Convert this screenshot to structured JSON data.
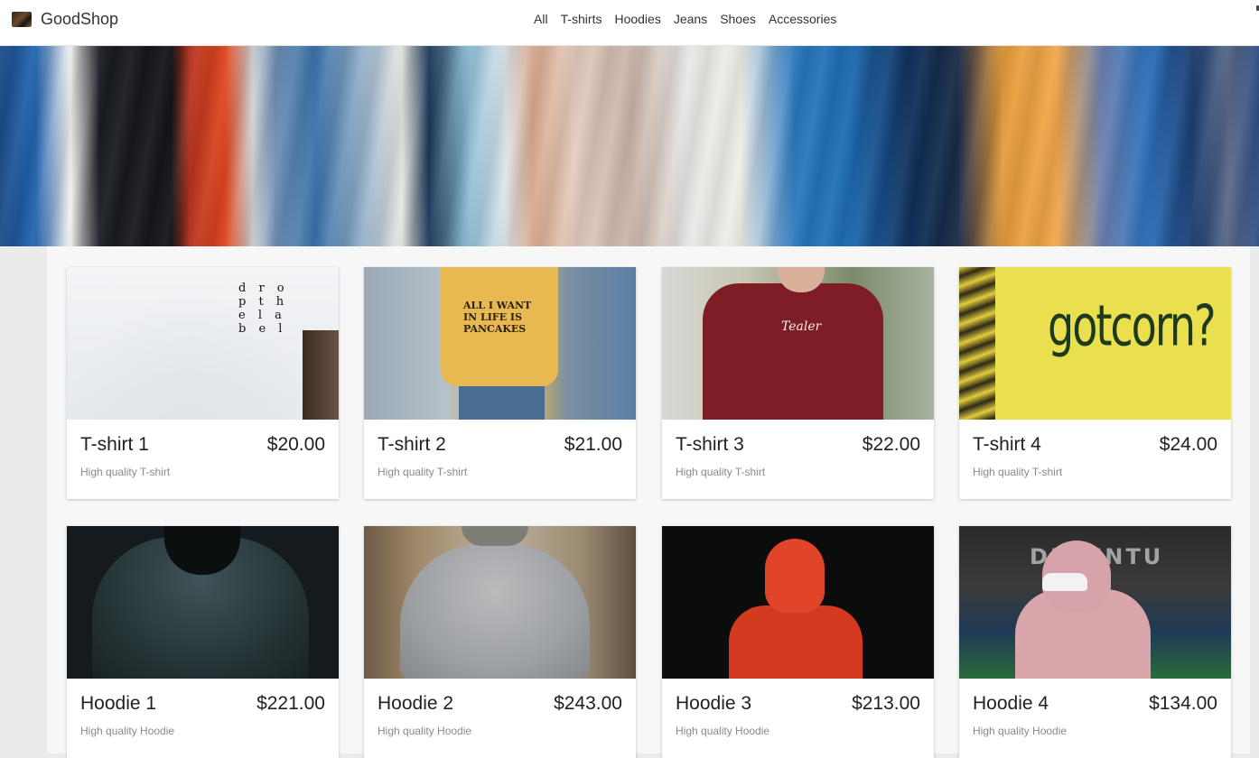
{
  "header": {
    "brand": "GoodShop",
    "nav": [
      "All",
      "T-shirts",
      "Hoodies",
      "Jeans",
      "Shoes",
      "Accessories"
    ]
  },
  "products": [
    {
      "name": "T-shirt 1",
      "price": "$20.00",
      "description": "High quality T-shirt",
      "image_print": "d r o\np t h\ne l a\nb e l"
    },
    {
      "name": "T-shirt 2",
      "price": "$21.00",
      "description": "High quality T-shirt",
      "image_print": "ALL I WANT\nIN LIFE IS\nPANCAKES"
    },
    {
      "name": "T-shirt 3",
      "price": "$22.00",
      "description": "High quality T-shirt",
      "image_print": "Tealer"
    },
    {
      "name": "T-shirt 4",
      "price": "$24.00",
      "description": "High quality T-shirt",
      "image_print": "gotcorn?"
    },
    {
      "name": "Hoodie 1",
      "price": "$221.00",
      "description": "High quality Hoodie"
    },
    {
      "name": "Hoodie 2",
      "price": "$243.00",
      "description": "High quality Hoodie"
    },
    {
      "name": "Hoodie 3",
      "price": "$213.00",
      "description": "High quality Hoodie"
    },
    {
      "name": "Hoodie 4",
      "price": "$134.00",
      "description": "High quality Hoodie",
      "image_print": "DEVENTU"
    }
  ]
}
